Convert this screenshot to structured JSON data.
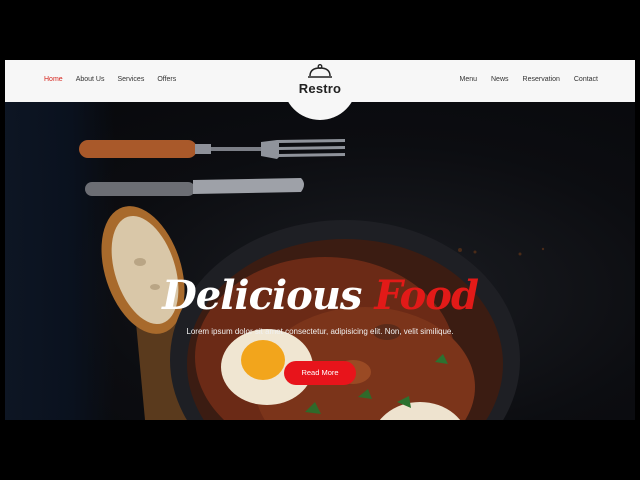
{
  "nav": {
    "left": [
      {
        "label": "Home",
        "active": true
      },
      {
        "label": "About Us"
      },
      {
        "label": "Services"
      },
      {
        "label": "Offers"
      }
    ],
    "right": [
      {
        "label": "Menu"
      },
      {
        "label": "News"
      },
      {
        "label": "Reservation"
      },
      {
        "label": "Contact"
      }
    ]
  },
  "brand": {
    "name": "Restro",
    "icon": "cloche-icon"
  },
  "hero": {
    "title_part1": "Delicious",
    "title_part2": "Food",
    "subtitle": "Lorem ipsum dolor sit amet consectetur, adipisicing elit. Non, velit similique.",
    "button_label": "Read More"
  },
  "colors": {
    "accent": "#e21a18",
    "navbar": "#f7f7f7",
    "background": "#000000"
  }
}
